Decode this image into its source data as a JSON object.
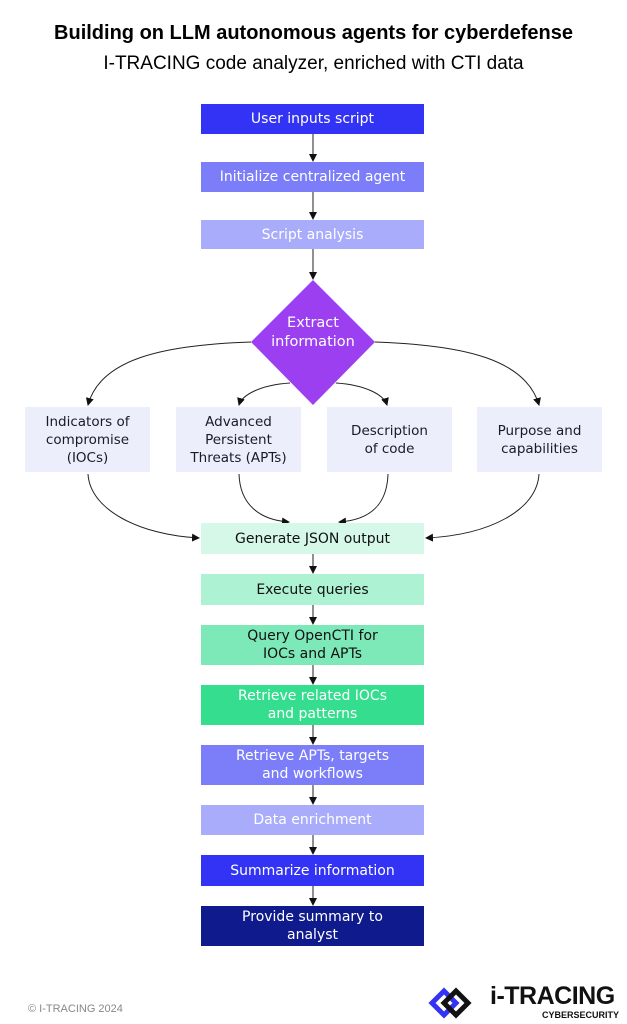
{
  "header": {
    "title": "Building on LLM autonomous agents for cyberdefense",
    "subtitle": "I-TRACING code analyzer, enriched with CTI data"
  },
  "colors": {
    "blue": "#3333f5",
    "mid_blue": "#7b7ef8",
    "light_blue": "#a9acfb",
    "purple": "#9b3ff0",
    "pale": "#eceffb",
    "green_pale": "#d6f8e8",
    "green_light": "#aef2d4",
    "green_mid": "#7de8b8",
    "green": "#35dd8f",
    "navy": "#0f1a8c"
  },
  "steps": [
    {
      "label": "User inputs script"
    },
    {
      "label": "Initialize centralized agent"
    },
    {
      "label": "Script analysis"
    }
  ],
  "decision": {
    "label": "Extract information"
  },
  "branches": [
    {
      "label": "Indicators of compromise (IOCs)"
    },
    {
      "label": "Advanced Persistent Threats (APTs)"
    },
    {
      "label": "Description of code"
    },
    {
      "label": "Purpose and capabilities"
    }
  ],
  "steps_after": [
    {
      "label": "Generate JSON output"
    },
    {
      "label": "Execute queries"
    },
    {
      "label": "Query OpenCTI for IOCs and APTs"
    },
    {
      "label": "Retrieve related IOCs and patterns"
    },
    {
      "label": "Retrieve APTs, targets and workflows"
    },
    {
      "label": "Data enrichment"
    },
    {
      "label": "Summarize information"
    },
    {
      "label": "Provide summary to analyst"
    }
  ],
  "footer": {
    "copyright": "© I-TRACING 2024",
    "logo": "i-TRACING",
    "logo_sub": "CYBERSECURITY"
  }
}
